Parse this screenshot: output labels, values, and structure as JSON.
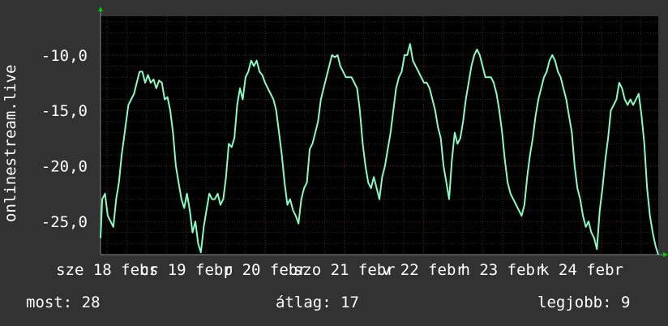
{
  "chart_data": {
    "type": "line",
    "ylabel": "onlinestream.live",
    "title": "",
    "y_ticks": [
      -10,
      -15,
      -20,
      -25
    ],
    "y_tick_labels": [
      "-10,0",
      "-15,0",
      "-20,0",
      "-25,0"
    ],
    "ylim": [
      -28,
      -6.5
    ],
    "x_tick_labels": [
      "sze 18  febr",
      "cs 19  febr",
      "p 20  febr",
      "szo 21  febr",
      "v 22  febr",
      "h 23  febr",
      "k 24  febr"
    ],
    "xlim": [
      0,
      100
    ],
    "grid": true,
    "colors": {
      "line": "#7fffc4",
      "background": "#000000",
      "grid": "#5a2020",
      "frame": "#323232",
      "axis_arrow": "#00cc00"
    },
    "series": [
      {
        "values": [
          [
            0,
            -26.5
          ],
          [
            0.3,
            -23
          ],
          [
            0.8,
            -22.5
          ],
          [
            1.3,
            -24.5
          ],
          [
            1.8,
            -25
          ],
          [
            2.3,
            -25.5
          ],
          [
            2.8,
            -23
          ],
          [
            3.3,
            -21.5
          ],
          [
            3.8,
            -19
          ],
          [
            4.2,
            -17.5
          ],
          [
            4.6,
            -16
          ],
          [
            5,
            -14.5
          ],
          [
            5.5,
            -14
          ],
          [
            6,
            -13.5
          ],
          [
            6.5,
            -12.5
          ],
          [
            7,
            -11.5
          ],
          [
            7.5,
            -11.5
          ],
          [
            8,
            -12.5
          ],
          [
            8.5,
            -11.8
          ],
          [
            9,
            -12.5
          ],
          [
            9.5,
            -12.2
          ],
          [
            10,
            -13
          ],
          [
            10.5,
            -12.3
          ],
          [
            11,
            -12.5
          ],
          [
            11.5,
            -14
          ],
          [
            12,
            -13.8
          ],
          [
            12.5,
            -15
          ],
          [
            13,
            -17
          ],
          [
            13.5,
            -20
          ],
          [
            14,
            -21.5
          ],
          [
            14.5,
            -23
          ],
          [
            15,
            -23.8
          ],
          [
            15.5,
            -22.5
          ],
          [
            16,
            -24
          ],
          [
            16.5,
            -26
          ],
          [
            17,
            -25
          ],
          [
            17.5,
            -27
          ],
          [
            18,
            -27.8
          ],
          [
            18.5,
            -25.5
          ],
          [
            19,
            -24
          ],
          [
            19.5,
            -22.5
          ],
          [
            20,
            -23
          ],
          [
            20.5,
            -23
          ],
          [
            21,
            -22.5
          ],
          [
            21.5,
            -23.5
          ],
          [
            22,
            -23
          ],
          [
            22.5,
            -21
          ],
          [
            23,
            -18
          ],
          [
            23.5,
            -18.3
          ],
          [
            24,
            -17.5
          ],
          [
            24.5,
            -14.5
          ],
          [
            25,
            -13
          ],
          [
            25.5,
            -14
          ],
          [
            26,
            -12
          ],
          [
            26.5,
            -11.5
          ],
          [
            27,
            -10.5
          ],
          [
            27.5,
            -11
          ],
          [
            28,
            -10.5
          ],
          [
            28.5,
            -11.5
          ],
          [
            29,
            -11.8
          ],
          [
            29.5,
            -12.5
          ],
          [
            30,
            -13
          ],
          [
            30.5,
            -13.5
          ],
          [
            31,
            -14
          ],
          [
            31.5,
            -15
          ],
          [
            32,
            -17
          ],
          [
            32.5,
            -19
          ],
          [
            33,
            -21.5
          ],
          [
            33.5,
            -23.5
          ],
          [
            34,
            -23
          ],
          [
            34.5,
            -24
          ],
          [
            35,
            -24.5
          ],
          [
            35.5,
            -25.2
          ],
          [
            36,
            -23
          ],
          [
            36.5,
            -22
          ],
          [
            37,
            -21.5
          ],
          [
            37.5,
            -18.5
          ],
          [
            38,
            -18
          ],
          [
            38.5,
            -17
          ],
          [
            39,
            -16
          ],
          [
            39.5,
            -14
          ],
          [
            40,
            -13
          ],
          [
            40.5,
            -12
          ],
          [
            41,
            -11
          ],
          [
            41.5,
            -10
          ],
          [
            42,
            -10.2
          ],
          [
            42.5,
            -10
          ],
          [
            43,
            -11
          ],
          [
            43.5,
            -11.5
          ],
          [
            44,
            -12
          ],
          [
            44.5,
            -12
          ],
          [
            45,
            -12
          ],
          [
            45.5,
            -12.5
          ],
          [
            46,
            -13
          ],
          [
            46.5,
            -15
          ],
          [
            47,
            -18
          ],
          [
            47.5,
            -20
          ],
          [
            48,
            -21.5
          ],
          [
            48.5,
            -22
          ],
          [
            49,
            -21
          ],
          [
            49.5,
            -22
          ],
          [
            50,
            -23
          ],
          [
            50.5,
            -21
          ],
          [
            51,
            -20
          ],
          [
            51.5,
            -18.5
          ],
          [
            52,
            -17
          ],
          [
            52.5,
            -15
          ],
          [
            53,
            -13
          ],
          [
            53.5,
            -12
          ],
          [
            54,
            -11.5
          ],
          [
            54.5,
            -10
          ],
          [
            55,
            -10
          ],
          [
            55.5,
            -9
          ],
          [
            56,
            -10.5
          ],
          [
            56.5,
            -11
          ],
          [
            57,
            -11.5
          ],
          [
            57.5,
            -12
          ],
          [
            58,
            -12.5
          ],
          [
            58.5,
            -12.5
          ],
          [
            59,
            -13
          ],
          [
            59.5,
            -14
          ],
          [
            60,
            -15
          ],
          [
            60.5,
            -16.5
          ],
          [
            61,
            -17.5
          ],
          [
            61.5,
            -20
          ],
          [
            62,
            -21.5
          ],
          [
            62.5,
            -23
          ],
          [
            63,
            -19.5
          ],
          [
            63.5,
            -17
          ],
          [
            64,
            -18
          ],
          [
            64.5,
            -17.5
          ],
          [
            65,
            -16
          ],
          [
            65.5,
            -14
          ],
          [
            66,
            -12.5
          ],
          [
            66.5,
            -11
          ],
          [
            67,
            -10
          ],
          [
            67.5,
            -9.5
          ],
          [
            68,
            -10
          ],
          [
            68.5,
            -11
          ],
          [
            69,
            -12
          ],
          [
            69.5,
            -12
          ],
          [
            70,
            -12
          ],
          [
            70.5,
            -12.5
          ],
          [
            71,
            -13.5
          ],
          [
            71.5,
            -15
          ],
          [
            72,
            -17
          ],
          [
            72.5,
            -19.5
          ],
          [
            73,
            -21.5
          ],
          [
            73.5,
            -22.5
          ],
          [
            74,
            -23
          ],
          [
            74.5,
            -23.5
          ],
          [
            75,
            -24
          ],
          [
            75.5,
            -24.5
          ],
          [
            76,
            -23.5
          ],
          [
            76.5,
            -21
          ],
          [
            77,
            -19
          ],
          [
            77.5,
            -17.5
          ],
          [
            78,
            -15.5
          ],
          [
            78.5,
            -14
          ],
          [
            79,
            -13
          ],
          [
            79.5,
            -12
          ],
          [
            80,
            -11.5
          ],
          [
            80.5,
            -10.5
          ],
          [
            81,
            -10
          ],
          [
            81.5,
            -10.5
          ],
          [
            82,
            -11.5
          ],
          [
            82.5,
            -12
          ],
          [
            83,
            -13
          ],
          [
            83.5,
            -14
          ],
          [
            84,
            -15.5
          ],
          [
            84.5,
            -17
          ],
          [
            85,
            -20
          ],
          [
            85.5,
            -22
          ],
          [
            86,
            -23
          ],
          [
            86.5,
            -24.5
          ],
          [
            87,
            -25.5
          ],
          [
            87.5,
            -25
          ],
          [
            88,
            -26
          ],
          [
            88.5,
            -26.5
          ],
          [
            89,
            -27.5
          ],
          [
            89.5,
            -24
          ],
          [
            90,
            -22
          ],
          [
            90.5,
            -19.5
          ],
          [
            91,
            -17.5
          ],
          [
            91.5,
            -15
          ],
          [
            92,
            -14.5
          ],
          [
            92.5,
            -14
          ],
          [
            93,
            -12.5
          ],
          [
            93.5,
            -13
          ],
          [
            94,
            -14
          ],
          [
            94.5,
            -14.5
          ],
          [
            95,
            -14
          ],
          [
            95.5,
            -14.5
          ],
          [
            96,
            -14
          ],
          [
            96.5,
            -13.5
          ],
          [
            97,
            -15.5
          ],
          [
            97.5,
            -18
          ],
          [
            98,
            -22
          ],
          [
            98.5,
            -24.5
          ],
          [
            99,
            -26
          ],
          [
            99.5,
            -27.2
          ],
          [
            100,
            -28
          ]
        ]
      }
    ]
  },
  "stats": {
    "now": "most: 28",
    "avg": "átlag: 17",
    "best": "legjobb: 9"
  }
}
